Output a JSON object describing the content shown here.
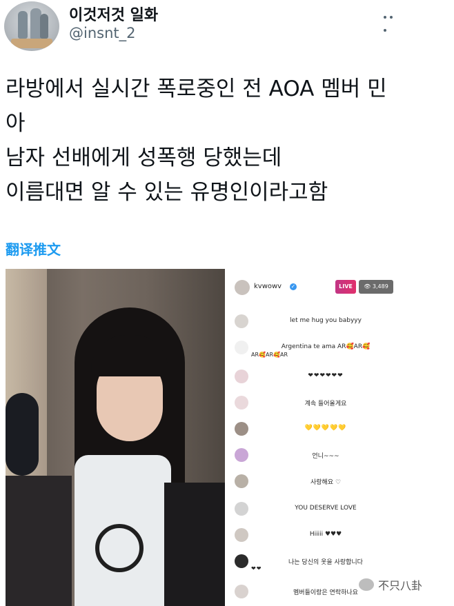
{
  "tweet": {
    "author_name": "이것저것 일화",
    "author_handle": "@insnt_2",
    "more_icon": "more-horizontal-icon",
    "text_lines": [
      "라방에서 실시간 폭로중인 전 AOA 멤버 민",
      "아",
      "남자 선배에게 성폭행 당했는데",
      "이름대면 알 수 있는 유명인이라고함"
    ],
    "translate_label": "翻译推文"
  },
  "live": {
    "username": "kvwowv",
    "live_label": "LIVE",
    "viewer_count": "3,489",
    "viewer_icon": "eye-icon",
    "comments": [
      {
        "text": "let me hug you babyyy",
        "extra": ""
      },
      {
        "text": "Argentina te ama AR🥰AR🥰",
        "extra": "AR🥰AR🥰AR"
      },
      {
        "text": "❤❤❤❤❤❤",
        "extra": ""
      },
      {
        "text": "계속 들어올게요",
        "extra": ""
      },
      {
        "text": "💛💛💛💛💛",
        "extra": ""
      },
      {
        "text": "언니~~~",
        "extra": ""
      },
      {
        "text": "사랑해요 ♡",
        "extra": ""
      },
      {
        "text": "YOU DESERVE LOVE",
        "extra": ""
      },
      {
        "text": "Hiiiii ♥♥♥",
        "extra": ""
      },
      {
        "text": "나는 당신의 옷을 사랑합니다",
        "extra": "❤❤"
      },
      {
        "text": "멤버들이랑은 연락하나요",
        "extra": ""
      }
    ]
  },
  "watermark": {
    "text": "不只八卦",
    "icon": "wechat-icon"
  },
  "colors": {
    "link": "#1d9bf0",
    "text": "#0f1419",
    "muted": "#536471",
    "live": "#e1306c"
  }
}
